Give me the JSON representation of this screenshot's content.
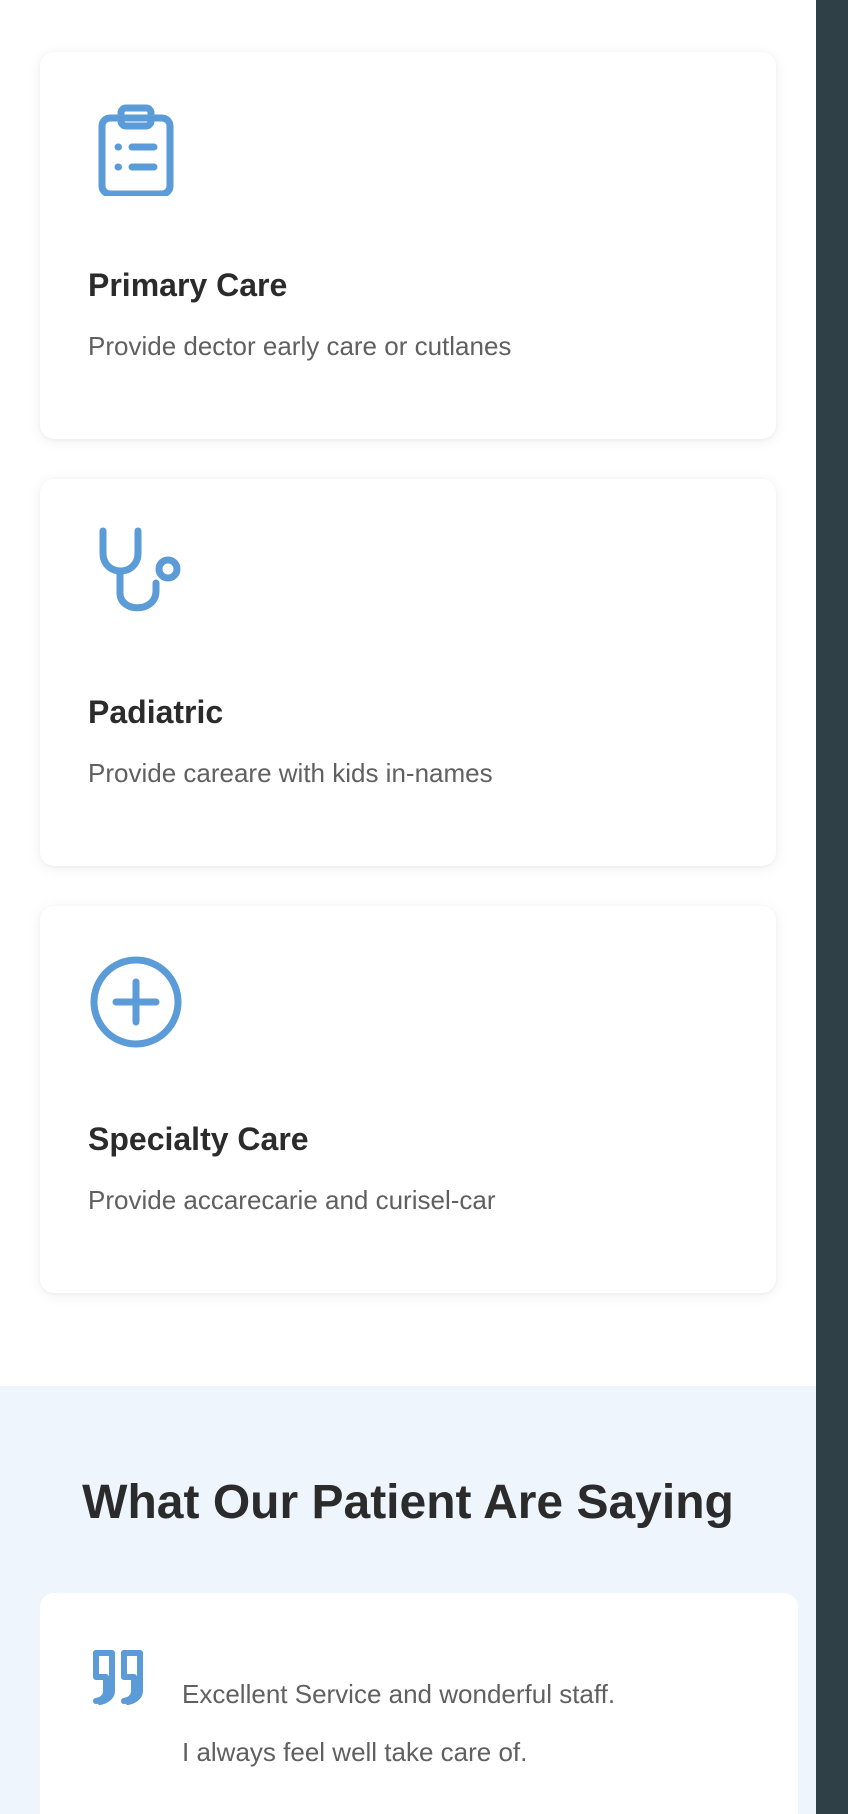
{
  "services": [
    {
      "icon": "clipboard-list-icon",
      "title": "Primary Care",
      "description": "Provide dector early care or cutlanes"
    },
    {
      "icon": "stethoscope-icon",
      "title": "Padiatric",
      "description": "Provide careare with kids in-names"
    },
    {
      "icon": "plus-circle-icon",
      "title": "Specialty Care",
      "description": "Provide accarecarie and curisel-car"
    }
  ],
  "testimonials": {
    "heading": "What Our Patient Are Saying",
    "quote_icon": "quote-icon",
    "quote_line_1": "Excellent Service and wonderful staff.",
    "quote_line_2": "I always feel well take care of."
  },
  "colors": {
    "accent": "#5a9bd8",
    "heading": "#2b2b2b",
    "body_text": "#606060",
    "section_bg": "#eef5fd",
    "sidebar_bg": "#2f4146"
  }
}
